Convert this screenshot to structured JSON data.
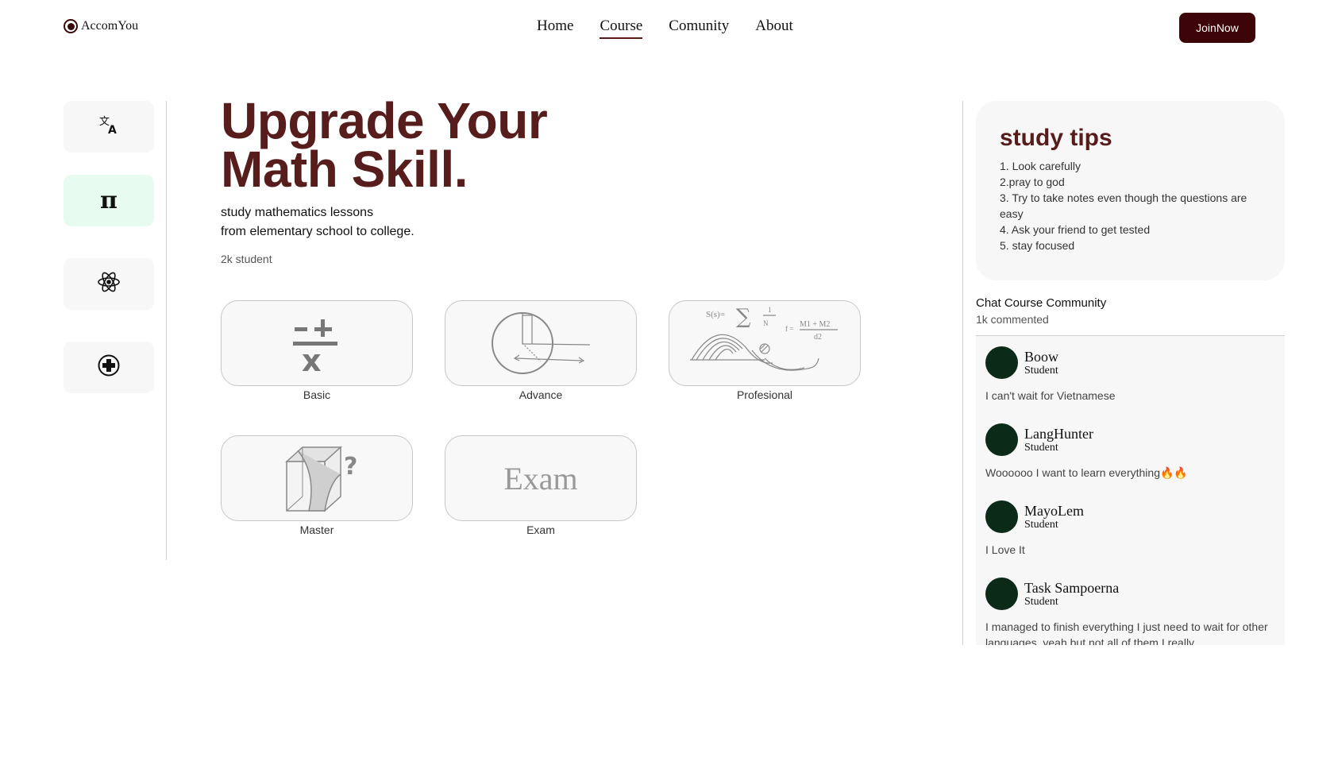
{
  "brand": {
    "name": "AccomYou"
  },
  "nav": {
    "items": [
      {
        "label": "Home",
        "active": false
      },
      {
        "label": "Course",
        "active": true
      },
      {
        "label": "Comunity",
        "active": false
      },
      {
        "label": "About",
        "active": false
      }
    ],
    "join_label": "JoinNow"
  },
  "sidebar": {
    "items": [
      {
        "icon": "translate-icon",
        "active": false
      },
      {
        "icon": "pi-icon",
        "glyph": "π",
        "active": true
      },
      {
        "icon": "atom-icon",
        "active": false
      },
      {
        "icon": "plus-circle-icon",
        "active": false
      }
    ]
  },
  "hero": {
    "title_line1": "Upgrade Your",
    "title_line2": "Math Skill.",
    "subtitle_line1": "study mathematics lessons",
    "subtitle_line2": "from elementary school to college.",
    "students": "2k student"
  },
  "courses": [
    {
      "label": "Basic",
      "illustration": "basic-operators"
    },
    {
      "label": "Advance",
      "illustration": "circle-geometry"
    },
    {
      "label": "Profesional",
      "illustration": "formula-wave",
      "formula_left": "S(s)=",
      "formula_right_top": "M1 + M2",
      "formula_right_bottom": "d2",
      "formula_f": "f =",
      "formula_frac_top": "1",
      "formula_frac_bottom": "N"
    },
    {
      "label": "Master",
      "illustration": "cube-question",
      "mark": "?"
    },
    {
      "label": "Exam",
      "illustration": "exam-text",
      "art_text": "Exam"
    }
  ],
  "study_tips": {
    "title": "study tips",
    "items": [
      "1. Look carefully",
      "2.pray to god",
      "3. Try to take notes even though the questions are easy",
      "4. Ask your friend to get tested",
      "5. stay focused"
    ]
  },
  "chat": {
    "title": "Chat Course Community",
    "count": "1k commented",
    "comments": [
      {
        "name": "Boow",
        "role": "Student",
        "text": "I can't wait for Vietnamese"
      },
      {
        "name": "LangHunter",
        "role": "Student",
        "text": "Woooooo I want to learn everything🔥🔥"
      },
      {
        "name": "MayoLem",
        "role": "Student",
        "text": "I Love It"
      },
      {
        "name": "Task Sampoerna",
        "role": "Student",
        "text": "I managed to finish everything I just need to wait for other languages, yeah but not all of them I really"
      }
    ]
  },
  "colors": {
    "brand_dark": "#3d0508",
    "title": "#571c1c",
    "avatar": "#0b2a18",
    "active_side": "#e8fbf0"
  }
}
